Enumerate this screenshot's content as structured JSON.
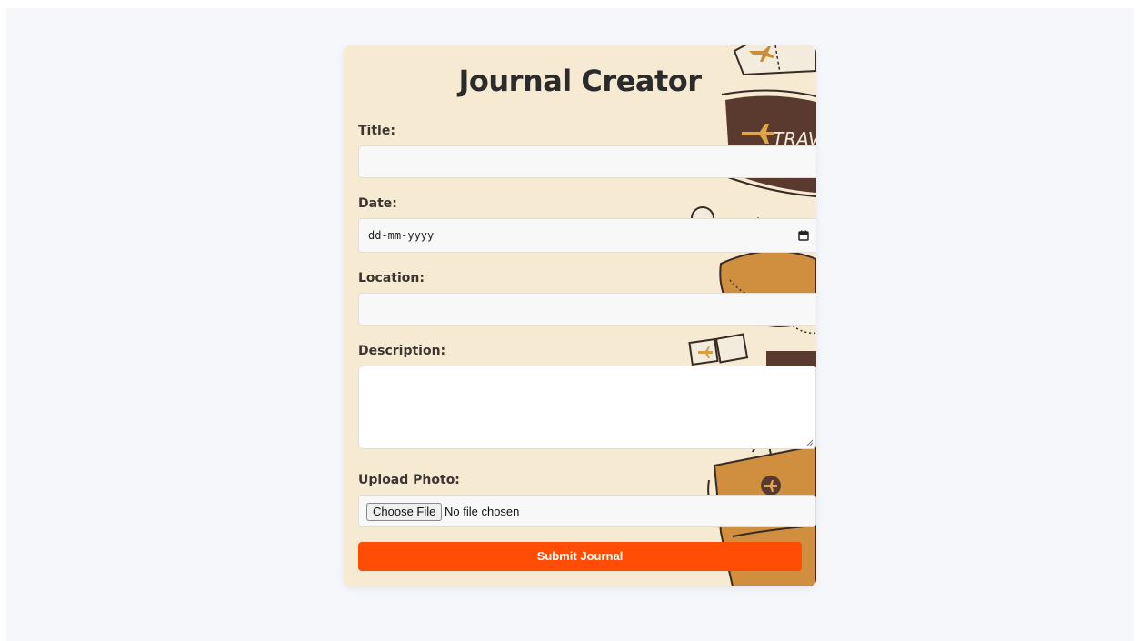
{
  "form": {
    "title": "Journal Creator",
    "labels": {
      "title": "Title:",
      "date": "Date:",
      "location": "Location:",
      "description": "Description:",
      "photo": "Upload Photo:"
    },
    "date_placeholder": "dd-mm-yyyy",
    "file_button": "Choose File",
    "file_status": "No file chosen",
    "submit_label": "Submit Journal",
    "decoration_text": "TRAV"
  },
  "colors": {
    "page_bg": "#f5f7fb",
    "card_bg": "#f7ead3",
    "accent": "#ff4d06",
    "decor_brown": "#5a3a2e",
    "decor_gold": "#d4a04a",
    "decor_orange": "#cf8f3f"
  },
  "icons": {
    "date": "calendar-icon",
    "decor": [
      "plane-icon",
      "ticket-icon",
      "suitcase-icon",
      "globe-icon",
      "stamp-icon"
    ]
  }
}
